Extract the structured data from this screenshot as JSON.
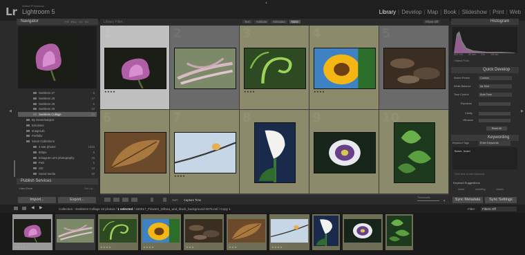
{
  "app": {
    "brand_small": "Adobe Photoshop",
    "name": "Lightroom 5",
    "logo": "Lr",
    "modules": [
      "Library",
      "Develop",
      "Map",
      "Book",
      "Slideshow",
      "Print",
      "Web"
    ],
    "active_module": "Library"
  },
  "navigator": {
    "title": "Navigator",
    "zoom_options": [
      "FIT",
      "FILL",
      "1:1",
      "3:1"
    ]
  },
  "collections": [
    {
      "label": "Seeklens 27",
      "count": "8"
    },
    {
      "label": "Seeklens 28",
      "count": "17"
    },
    {
      "label": "Seeklens 29",
      "count": "5"
    },
    {
      "label": "Seeklens 30",
      "count": "10"
    },
    {
      "label": "Seeklens Collage",
      "count": "10",
      "selected": true
    },
    {
      "label": "By Genre/subject",
      "count": ""
    },
    {
      "label": "Emotions",
      "count": ""
    },
    {
      "label": "ImageLab",
      "count": ""
    },
    {
      "label": "Portfolio",
      "count": ""
    },
    {
      "label": "Smart Collections",
      "count": ""
    },
    {
      "label": "4-star photos",
      "count": "1023"
    },
    {
      "label": "500px",
      "count": "8"
    },
    {
      "label": "Instagram arm photography",
      "count": "16"
    },
    {
      "label": "Pets",
      "count": "5"
    },
    {
      "label": "SIC",
      "count": "13"
    },
    {
      "label": "Social media",
      "count": "40"
    }
  ],
  "publish": {
    "title": "Publish Services",
    "hard_drive": "Hard Drive",
    "hard_drive_action": "Set Up..."
  },
  "buttons": {
    "import": "Import...",
    "export": "Export...",
    "sync_metadata": "Sync Metadata",
    "sync_settings": "Sync Settings"
  },
  "library_filter": {
    "label": "Library Filter :",
    "tabs": [
      "Text",
      "Attribute",
      "Metadata",
      "None"
    ],
    "active": "None",
    "filters_off": "Filters Off"
  },
  "grid": {
    "cells": [
      {
        "num": "1",
        "subject": "flower-purple",
        "stars": "★★★★",
        "selected": true
      },
      {
        "num": "2",
        "subject": "grass-pink",
        "stars": ""
      },
      {
        "num": "3",
        "subject": "fern-green",
        "stars": "★★★★"
      },
      {
        "num": "4",
        "subject": "sunflower",
        "stars": "★★★★"
      },
      {
        "num": "5",
        "subject": "leaves-brown",
        "stars": ""
      },
      {
        "num": "6",
        "subject": "leaf-autumn",
        "stars": ""
      },
      {
        "num": "7",
        "subject": "bud-sky",
        "stars": "★★★★"
      },
      {
        "num": "8",
        "subject": "calla-lily",
        "stars": ""
      },
      {
        "num": "9",
        "subject": "passion-flower",
        "stars": ""
      },
      {
        "num": "10",
        "subject": "ivy-leaves",
        "stars": ""
      }
    ]
  },
  "toolbar": {
    "sort_label": "Sort:",
    "sort_value": "Capture Time",
    "thumbnails_label": "Thumbnails"
  },
  "histogram": {
    "title": "Histogram",
    "iso": "ISO 100",
    "focal": "45 mm",
    "aperture": "f/11",
    "shutter": "1/6 sec",
    "original_photo": "Original Photo"
  },
  "quick_develop": {
    "title": "Quick Develop",
    "saved_preset_label": "Saved Preset",
    "saved_preset_value": "Custom",
    "white_balance_label": "White Balance",
    "white_balance_value": "As Shot",
    "tone_control_label": "Tone Control",
    "tone_control_value": "Auto Tone",
    "exposure_label": "Exposure",
    "clarity_label": "Clarity",
    "vibrance_label": "Vibrance",
    "reset_all": "Reset All"
  },
  "keywording": {
    "title": "Keywording",
    "tags_label": "Keyword Tags",
    "tags_value": "Enter Keywords",
    "keywords_text": "flower, Israel",
    "click_hint": "Click here to add keywords",
    "suggestions_title": "Keyword Suggestions",
    "suggestions": [
      "Israel",
      "wedding",
      "beach"
    ]
  },
  "filmstrip": {
    "collection_label": "Collection : Seeklens Collage",
    "photo_count": "10 photos /",
    "selected": "1 selected",
    "file_path": "/ 150017_Flowers_Gilboa_and_black_background-0076.nef / Copy 1",
    "filter_label": "Filter :",
    "filter_value": "Filters Off",
    "thumbs": [
      {
        "subject": "flower-purple",
        "stars": "★★★★"
      },
      {
        "subject": "grass-pink",
        "stars": ""
      },
      {
        "subject": "fern-green",
        "stars": "★★★★"
      },
      {
        "subject": "sunflower",
        "stars": "★★★★"
      },
      {
        "subject": "leaves-brown",
        "stars": "★★★"
      },
      {
        "subject": "leaf-autumn",
        "stars": "★★★"
      },
      {
        "subject": "bud-sky",
        "stars": "★★★★"
      },
      {
        "subject": "calla-lily",
        "stars": ""
      },
      {
        "subject": "passion-flower",
        "stars": ""
      },
      {
        "subject": "ivy-leaves",
        "stars": ""
      }
    ]
  },
  "colors": {
    "grid_bg": "#3d3d3d",
    "cell_olive": "#8b8b6c",
    "cell_selected": "#bfbfbf",
    "cell_gray": "#6a6a6a"
  }
}
